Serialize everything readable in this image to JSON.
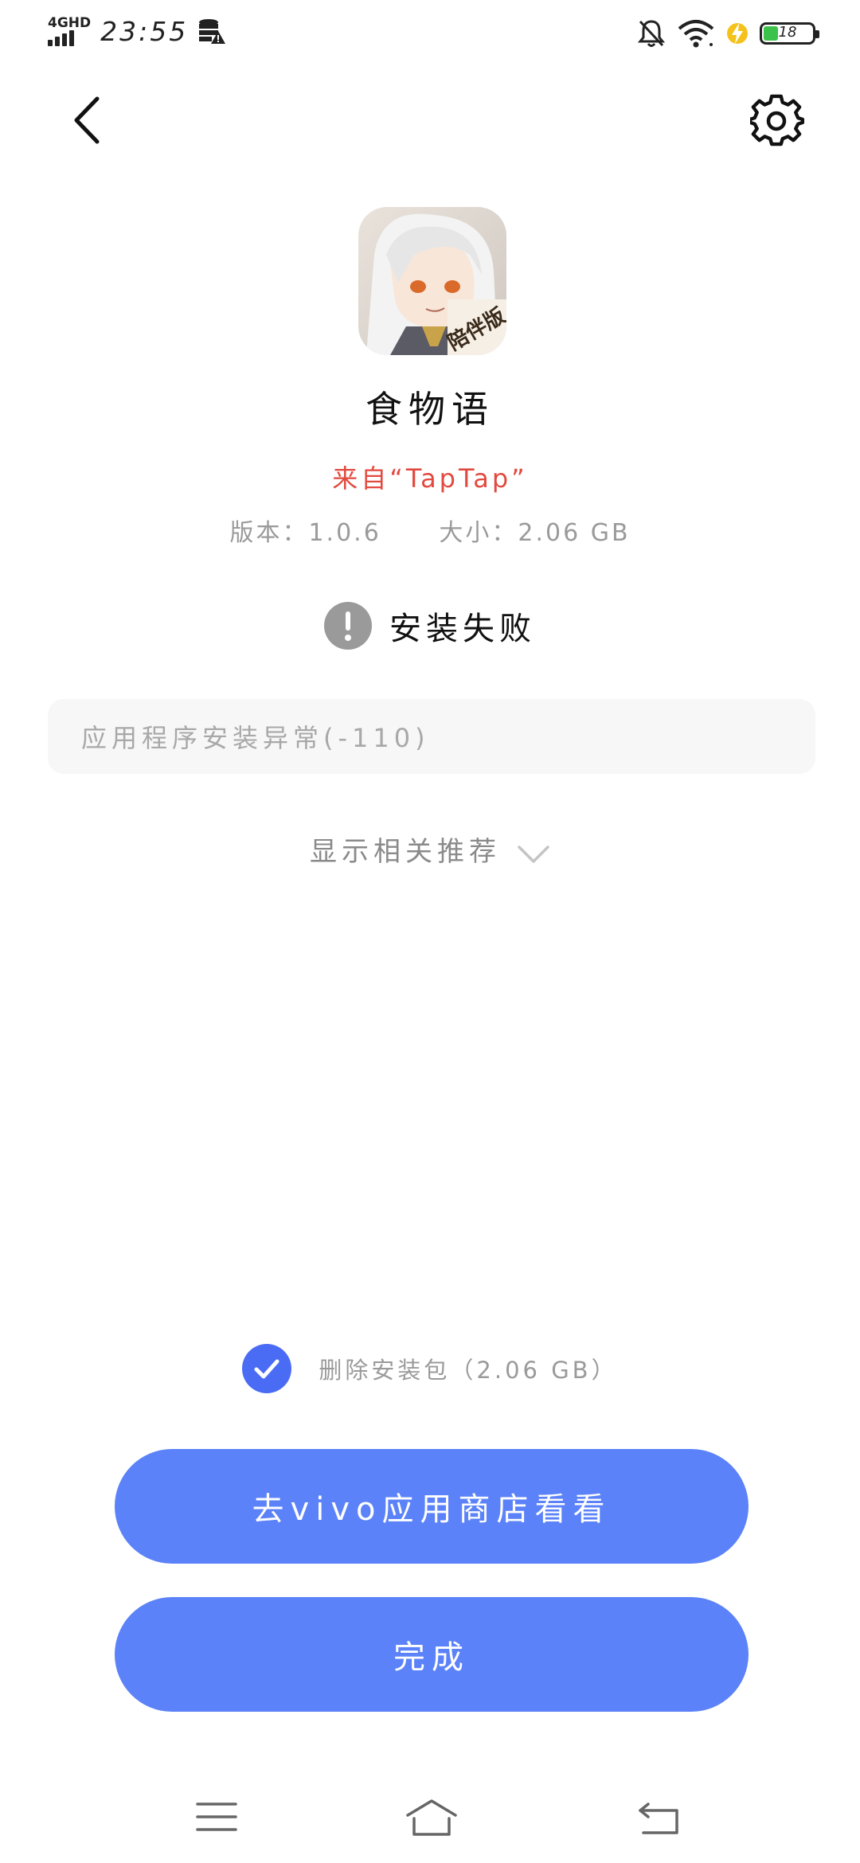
{
  "status_bar": {
    "network": "4GHD",
    "time": "23:55",
    "battery": "18",
    "battery_level_percent": 18,
    "icons": [
      "signal-icon",
      "database-warning-icon",
      "mute-bell-icon",
      "wifi-icon",
      "charging-icon",
      "battery-icon"
    ]
  },
  "header": {
    "back_icon": "chevron-left-icon",
    "settings_icon": "gear-icon"
  },
  "app": {
    "icon_badge": "陪伴版",
    "name": "食物语",
    "source": "来自“TapTap”",
    "version": "版本：1.0.6",
    "size": "大小：2.06 GB"
  },
  "result": {
    "text": "安装失败",
    "icon": "exclamation-circle-icon"
  },
  "error_message": "应用程序安装异常(-110)",
  "recommend_label": "显示相关推荐",
  "delete_package": {
    "label": "删除安装包（2.06 GB）",
    "checked": true
  },
  "buttons": {
    "store": "去vivo应用商店看看",
    "done": "完成"
  },
  "colors": {
    "accent": "#5b82f8",
    "checkbox": "#4a6cf5",
    "source_red": "#e2493f",
    "battery_green": "#3cc24a"
  },
  "nav_bar": {
    "icons": [
      "menu-icon",
      "home-icon",
      "back-icon"
    ]
  }
}
